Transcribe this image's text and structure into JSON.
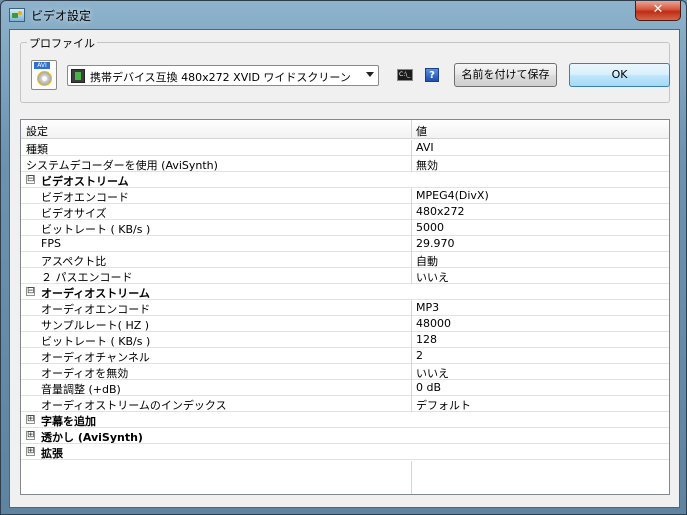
{
  "window": {
    "title": "ビデオ設定",
    "close_label": "✕"
  },
  "profile": {
    "group_label": "プロファイル",
    "avi_icon_tag": "AVI",
    "selected_value": "携帯デバイス互換 480x272 XVID ワイドスクリーン",
    "cmd_icon_label": "C:\\_",
    "help_icon_label": "?",
    "save_button_label": "名前を付けて保存",
    "ok_button_label": "OK"
  },
  "grid": {
    "header_key": "設定",
    "header_value": "値",
    "rows": [
      {
        "key": "種類",
        "value": "AVI"
      },
      {
        "key": "システムデコーダーを使用 (AviSynth)",
        "value": "無効"
      },
      {
        "key": "ビデオストリーム",
        "toggle": "⊟"
      },
      {
        "key": "ビデオエンコード",
        "value": "MPEG4(DivX)"
      },
      {
        "key": "ビデオサイズ",
        "value": "480x272"
      },
      {
        "key": "ビットレート ( KB/s )",
        "value": "5000"
      },
      {
        "key": "FPS",
        "value": "29.970"
      },
      {
        "key": "アスペクト比",
        "value": "自動"
      },
      {
        "key": "２ パスエンコード",
        "value": "いいえ"
      },
      {
        "key": "オーディオストリーム",
        "toggle": "⊟"
      },
      {
        "key": "オーディオエンコード",
        "value": "MP3"
      },
      {
        "key": "サンプルレート( HZ )",
        "value": "48000"
      },
      {
        "key": "ビットレート ( KB/s )",
        "value": "128"
      },
      {
        "key": "オーディオチャンネル",
        "value": "2"
      },
      {
        "key": "オーディオを無効",
        "value": "いいえ"
      },
      {
        "key": "音量調整 (+dB)",
        "value": "0 dB"
      },
      {
        "key": "オーディオストリームのインデックス",
        "value": "デフォルト"
      },
      {
        "key": "字幕を追加",
        "toggle": "⊞"
      },
      {
        "key": "透かし (AviSynth)",
        "toggle": "⊞"
      },
      {
        "key": "拡張",
        "toggle": "⊞"
      }
    ]
  }
}
